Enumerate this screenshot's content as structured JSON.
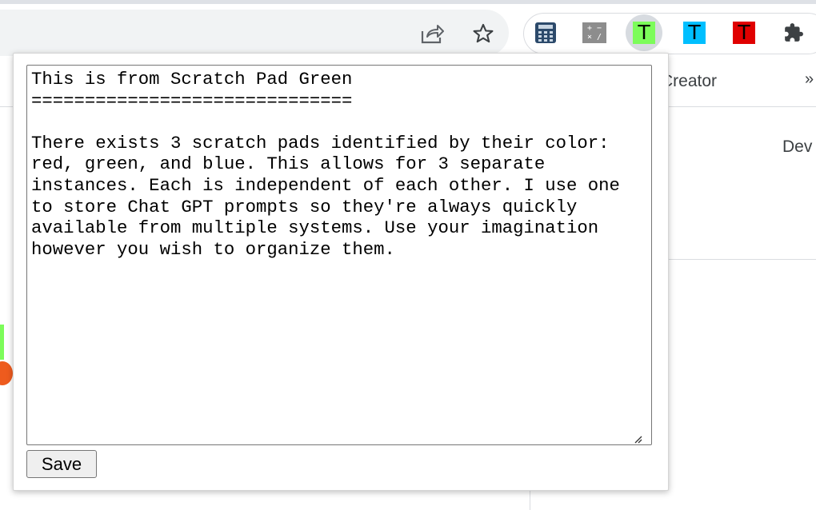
{
  "toolbar": {
    "share_icon": "share-icon",
    "star_icon": "star-icon",
    "extensions": [
      {
        "name": "calculator-icon"
      },
      {
        "name": "calculator-gray-icon",
        "glyphs": [
          "+",
          "−",
          "×",
          "/"
        ]
      },
      {
        "name": "scratch-pad-green-icon",
        "letter": "T",
        "color": "#7CFC5A",
        "active": true
      },
      {
        "name": "scratch-pad-blue-icon",
        "letter": "T",
        "color": "#00BFFF"
      },
      {
        "name": "scratch-pad-red-icon",
        "letter": "T",
        "color": "#E00000"
      },
      {
        "name": "puzzle-icon"
      }
    ]
  },
  "background_page": {
    "tab_label": "Creator",
    "overflow_label": "»",
    "right_text": "Dev"
  },
  "popup": {
    "textarea_value": "This is from Scratch Pad Green\n==============================\n\nThere exists 3 scratch pads identified by their color: red, green, and blue. This allows for 3 separate instances. Each is independent of each other. I use one to store Chat GPT prompts so they're always quickly available from multiple systems. Use your imagination however you wish to organize them.",
    "save_label": "Save"
  },
  "colors": {
    "accent_green": "#7CFC5A",
    "accent_blue": "#00BFFF",
    "accent_red": "#E00000",
    "toolbar_bg": "#f1f3f4"
  }
}
